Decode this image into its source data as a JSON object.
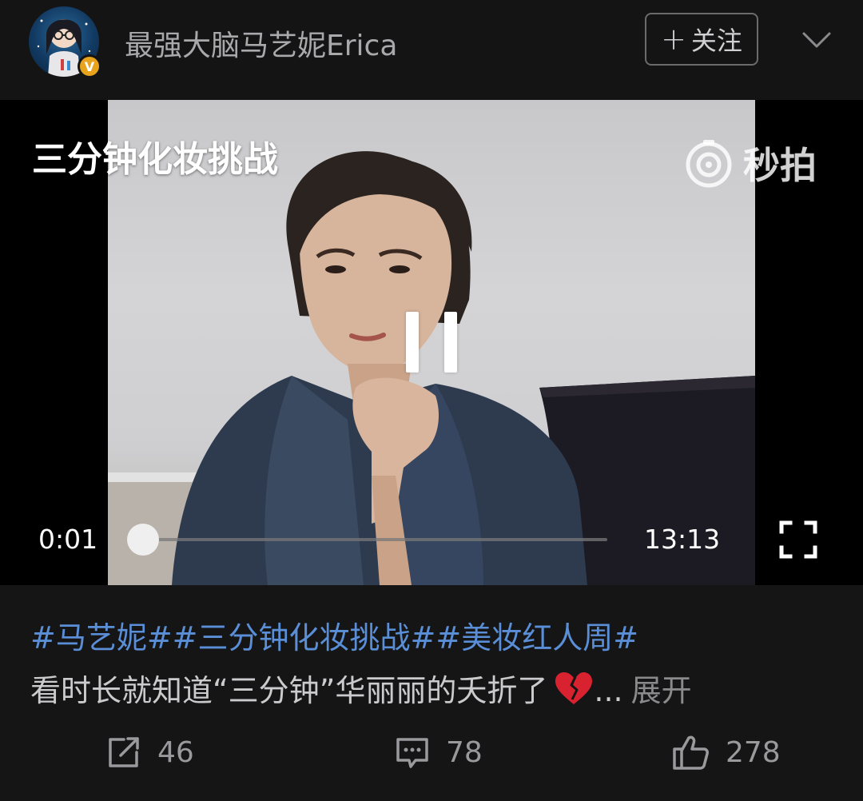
{
  "header": {
    "username": "最强大脑马艺妮Erica",
    "verified_badge": "V",
    "follow_label": "关注",
    "follow_icon": "plus-icon",
    "menu_icon": "chevron-down-icon"
  },
  "video": {
    "title_overlay": "三分钟化妆挑战",
    "watermark_text": "秒拍",
    "watermark_icon": "miaopai-logo-icon",
    "state": "playing",
    "current_time": "0:01",
    "total_time": "13:13",
    "progress_fraction": 0.001,
    "fullscreen_icon": "fullscreen-icon"
  },
  "post": {
    "hashtags": "#马艺妮##三分钟化妆挑战##美妆红人周#",
    "caption": "看时长就知道“三分钟”华丽丽的夭折了",
    "caption_emoji": "broken-heart-icon",
    "ellipsis": "...",
    "expand_label": "展开"
  },
  "actions": {
    "share_count": "46",
    "comment_count": "78",
    "like_count": "278"
  },
  "colors": {
    "background": "#151516",
    "hashtag": "#5a8ed6",
    "verified": "#e8a31d"
  }
}
